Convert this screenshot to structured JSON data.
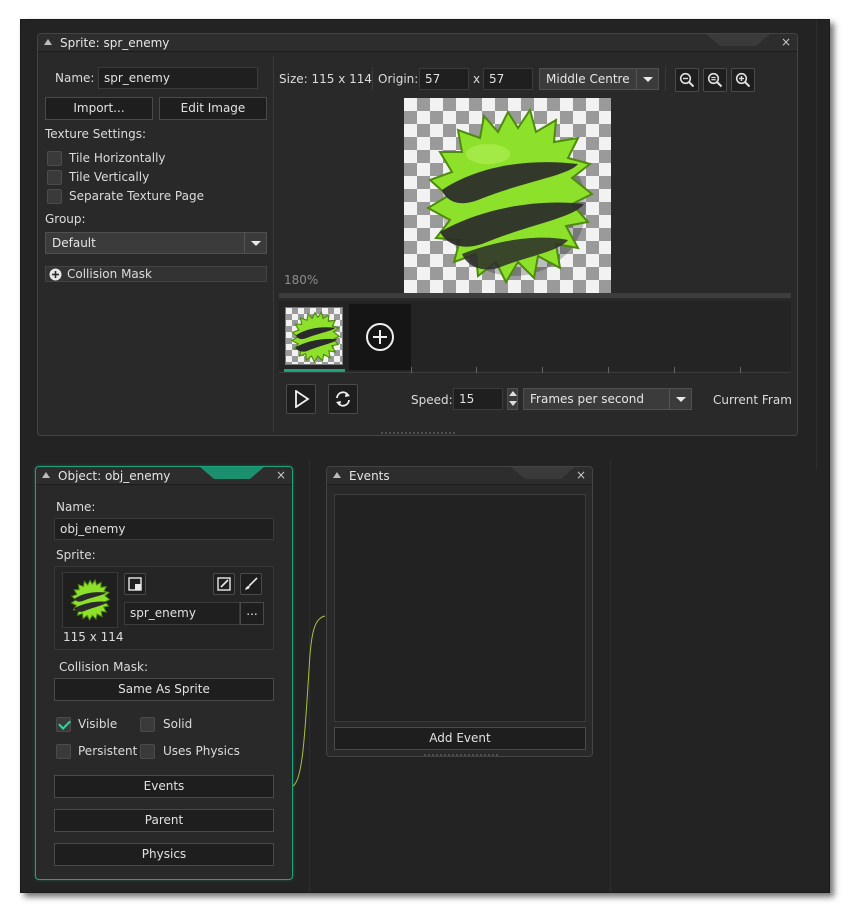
{
  "sprite_window": {
    "title": "Sprite: spr_enemy",
    "name_label": "Name:",
    "name_value": "spr_enemy",
    "import_label": "Import...",
    "edit_image_label": "Edit Image",
    "texture_settings_label": "Texture Settings:",
    "tile_horizontally": "Tile Horizontally",
    "tile_vertically": "Tile Vertically",
    "separate_texture_page": "Separate Texture Page",
    "group_label": "Group:",
    "group_value": "Default",
    "collision_mask_label": "Collision Mask",
    "size_text": "Size: 115 x 114",
    "origin_label": "Origin:",
    "origin_x": "57",
    "origin_sep": "x",
    "origin_y": "57",
    "origin_preset": "Middle Centre",
    "zoom_text": "180%",
    "speed_label": "Speed:",
    "speed_value": "15",
    "speed_unit": "Frames per second",
    "current_frame_label": "Current Frame"
  },
  "object_window": {
    "title": "Object: obj_enemy",
    "name_label": "Name:",
    "name_value": "obj_enemy",
    "sprite_label": "Sprite:",
    "sprite_size": "115 x 114",
    "sprite_value": "spr_enemy",
    "browse_label": "...",
    "collision_mask_label": "Collision Mask:",
    "collision_mask_value": "Same As Sprite",
    "visible_label": "Visible",
    "solid_label": "Solid",
    "persistent_label": "Persistent",
    "uses_physics_label": "Uses Physics",
    "events_label": "Events",
    "parent_label": "Parent",
    "physics_label": "Physics"
  },
  "events_window": {
    "title": "Events",
    "add_event_label": "Add Event"
  },
  "close_glyph": "×",
  "colors": {
    "accent": "#1fa37d",
    "sprite_green": "#7ed321",
    "check": "#2fd79b"
  }
}
